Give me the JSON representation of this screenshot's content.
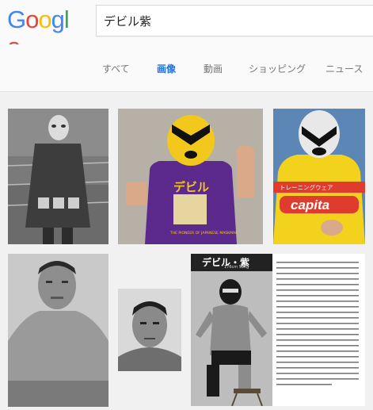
{
  "logo": {
    "letters": [
      "G",
      "o",
      "o",
      "g",
      "l",
      "e"
    ],
    "colors": [
      "#4285f4",
      "#ea4335",
      "#fbbc05",
      "#4285f4",
      "#34a853",
      "#ea4335"
    ]
  },
  "search": {
    "value": "デビル紫"
  },
  "tabs": [
    {
      "label": "すべて",
      "active": false
    },
    {
      "label": "画像",
      "active": true
    },
    {
      "label": "動画",
      "active": false
    },
    {
      "label": "ショッピング",
      "active": false
    },
    {
      "label": "ニュース",
      "active": false
    }
  ],
  "accent_color": "#1a73e8",
  "results": [
    {
      "name": "masked-wrestler-in-ring-bw"
    },
    {
      "name": "yellow-mask-purple-tshirt",
      "shirt_text": "デビル",
      "shirt_sub": "THE PIONEER OF JAPANESE MASKMAN"
    },
    {
      "name": "mask-capita-shirt",
      "shirt_band": "トレーニングウェア",
      "shirt_brand": "capita"
    },
    {
      "name": "wrestler-portrait-bw"
    },
    {
      "name": "wrestler-headshot-bw"
    },
    {
      "name": "magazine-profile",
      "title": "デビル・紫",
      "subtitle": "176cm 92kg"
    }
  ]
}
